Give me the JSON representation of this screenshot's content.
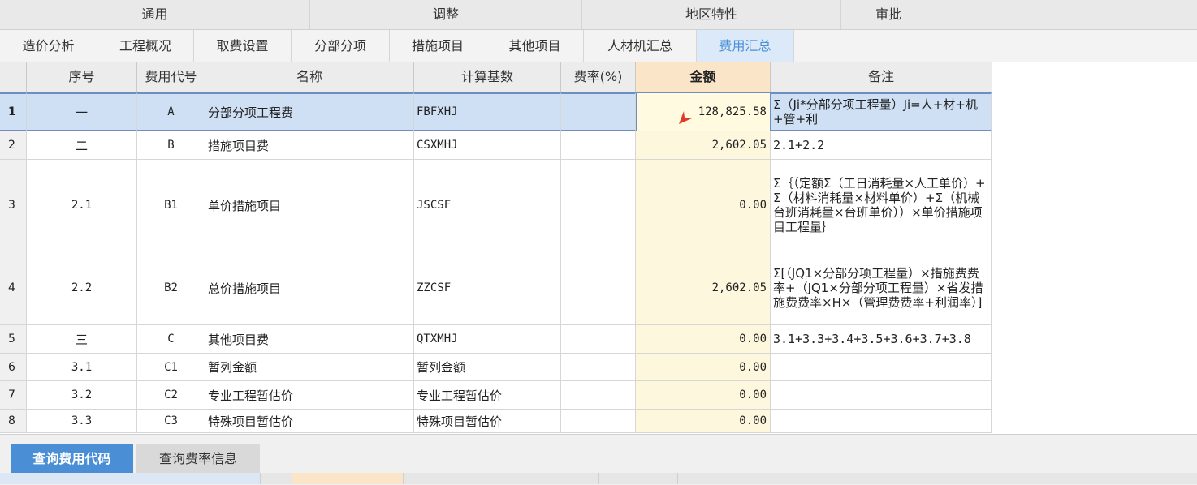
{
  "top_groups": [
    "通用",
    "调整",
    "地区特性",
    "审批"
  ],
  "tabs": [
    "造价分析",
    "工程概况",
    "取费设置",
    "分部分项",
    "措施项目",
    "其他项目",
    "人材机汇总",
    "费用汇总"
  ],
  "active_tab": "费用汇总",
  "table": {
    "headers": {
      "seq": "序号",
      "code": "费用代号",
      "name": "名称",
      "base": "计算基数",
      "rate": "费率(%)",
      "amount": "金额",
      "remark": "备注"
    },
    "rows": [
      {
        "num": "1",
        "seq": "一",
        "code": "A",
        "name": "分部分项工程费",
        "base": "FBFXHJ",
        "rate": "",
        "amount": "128,825.58",
        "remark": "Σ（Ji*分部分项工程量）Ji=人+材+机+管+利"
      },
      {
        "num": "2",
        "seq": "二",
        "code": "B",
        "name": "措施项目费",
        "base": "CSXMHJ",
        "rate": "",
        "amount": "2,602.05",
        "remark": "2.1+2.2"
      },
      {
        "num": "3",
        "seq": "2.1",
        "code": "B1",
        "name": "单价措施项目",
        "base": "JSCSF",
        "rate": "",
        "amount": "0.00",
        "remark": "Σ｛（定额Σ（工日消耗量×人工单价）+Σ（材料消耗量×材料单价）+Σ（机械台班消耗量×台班单价））×单价措施项目工程量｝"
      },
      {
        "num": "4",
        "seq": "2.2",
        "code": "B2",
        "name": "总价措施项目",
        "base": "ZZCSF",
        "rate": "",
        "amount": "2,602.05",
        "remark": "Σ[（JQ1×分部分项工程量）×措施费费率+（JQ1×分部分项工程量）×省发措施费费率×H×（管理费费率+利润率）]"
      },
      {
        "num": "5",
        "seq": "三",
        "code": "C",
        "name": "其他项目费",
        "base": "QTXMHJ",
        "rate": "",
        "amount": "0.00",
        "remark": "3.1+3.3+3.4+3.5+3.6+3.7+3.8"
      },
      {
        "num": "6",
        "seq": "3.1",
        "code": "C1",
        "name": "暂列金额",
        "base": "暂列金额",
        "rate": "",
        "amount": "0.00",
        "remark": ""
      },
      {
        "num": "7",
        "seq": "3.2",
        "code": "C2",
        "name": "专业工程暂估价",
        "base": "专业工程暂估价",
        "rate": "",
        "amount": "0.00",
        "remark": ""
      },
      {
        "num": "8",
        "seq": "3.3",
        "code": "C3",
        "name": "特殊项目暂估价",
        "base": "特殊项目暂估价",
        "rate": "",
        "amount": "0.00",
        "remark": ""
      }
    ]
  },
  "bottom_tabs": [
    "查询费用代码",
    "查询费率信息"
  ],
  "active_bottom_tab": "查询费用代码",
  "colors": {
    "accent": "#4a8fd6",
    "amount_header": "#fbe5c8",
    "selection": "#cfe0f5",
    "cursor": "#e03a2a"
  }
}
